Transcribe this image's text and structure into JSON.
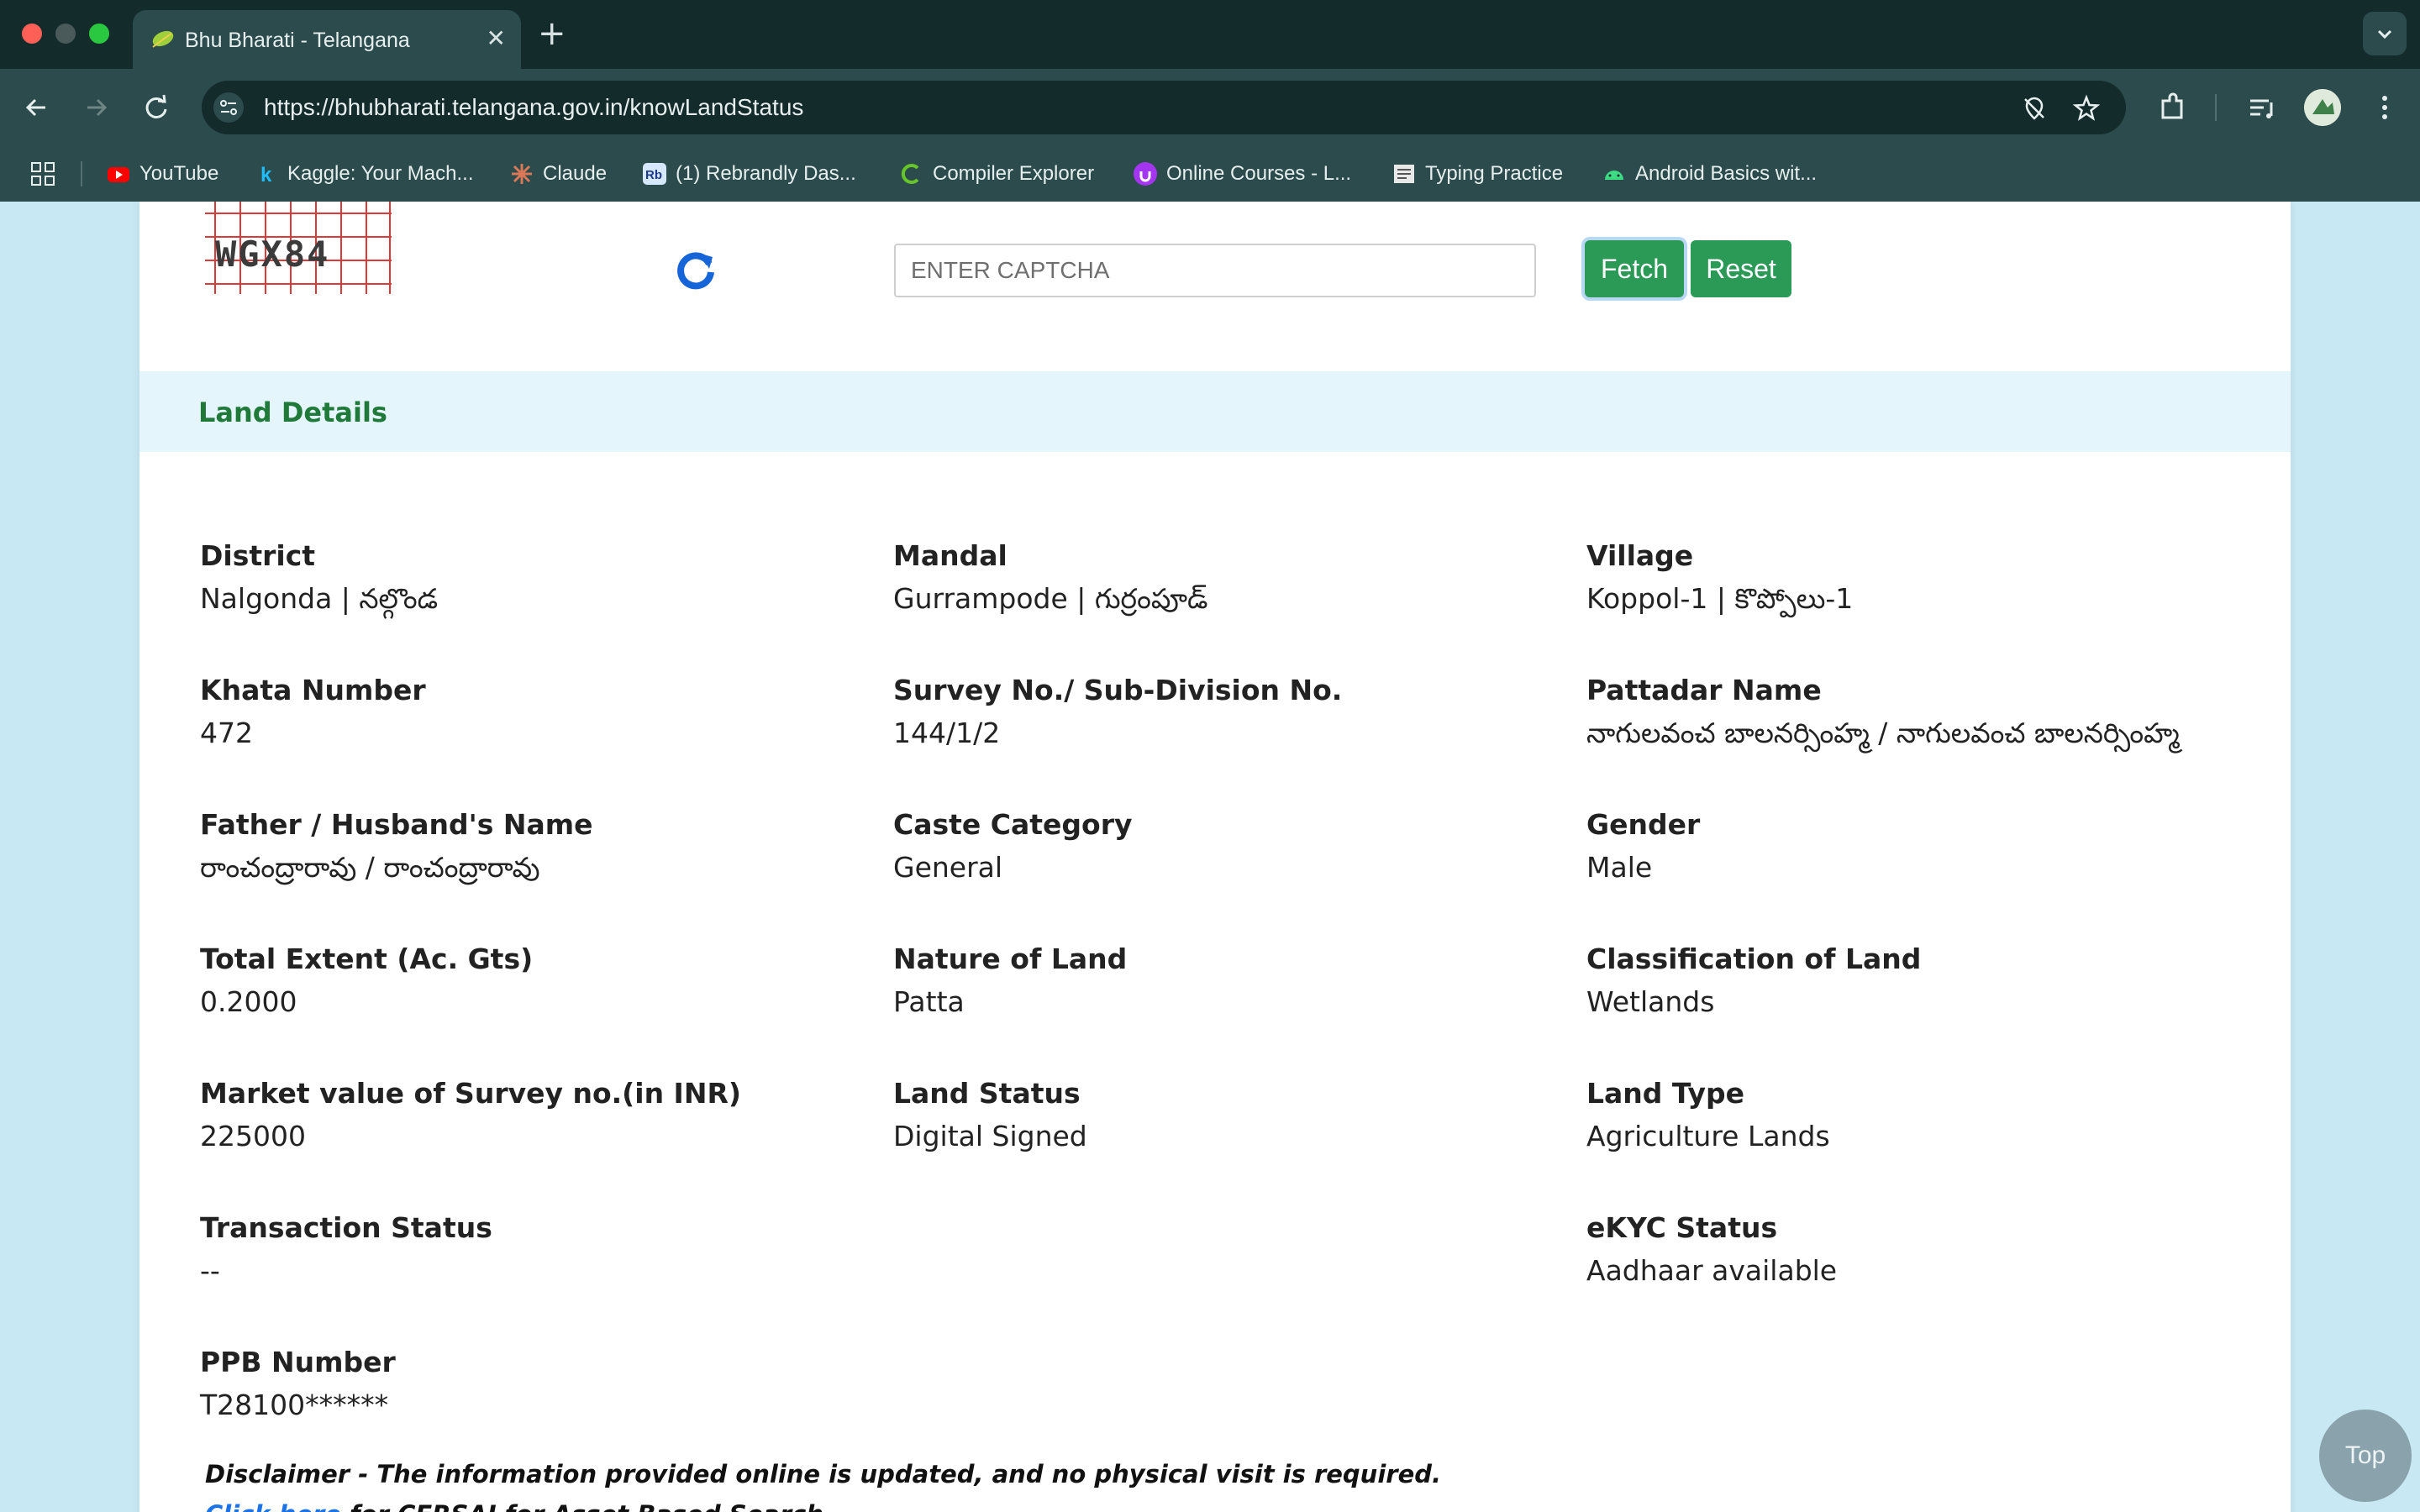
{
  "browser": {
    "tab_title": "Bhu Bharati - Telangana",
    "tab_close": "✕",
    "new_tab": "+",
    "url": "https://bhubharati.telangana.gov.in/knowLandStatus",
    "bookmarks": [
      {
        "label": "YouTube",
        "icon": "youtube-icon"
      },
      {
        "label": "Kaggle: Your Mach...",
        "icon": "kaggle-icon"
      },
      {
        "label": "Claude",
        "icon": "claude-icon"
      },
      {
        "label": "(1) Rebrandly Das...",
        "icon": "rebrandly-icon"
      },
      {
        "label": "Compiler Explorer",
        "icon": "compiler-explorer-icon"
      },
      {
        "label": "Online Courses - L...",
        "icon": "udemy-icon"
      },
      {
        "label": "Typing Practice",
        "icon": "typing-icon"
      },
      {
        "label": "Android Basics wit...",
        "icon": "android-icon"
      }
    ]
  },
  "captcha": {
    "code": "WGX84",
    "placeholder": "ENTER CAPTCHA",
    "fetch_label": "Fetch",
    "reset_label": "Reset"
  },
  "section": {
    "title": "Land Details"
  },
  "fields": {
    "district": {
      "label": "District",
      "value": "Nalgonda | నల్గొండ"
    },
    "mandal": {
      "label": "Mandal",
      "value": "Gurrampode | గుర్రంపూడ్"
    },
    "village": {
      "label": "Village",
      "value": "Koppol-1 | కొప్పోలు-1"
    },
    "khata": {
      "label": "Khata Number",
      "value": "472"
    },
    "survey": {
      "label": "Survey No./ Sub-Division No.",
      "value": "144/1/2"
    },
    "pattadar": {
      "label": "Pattadar Name",
      "value": "నాగులవంచ బాలనర్సింహ్మ / నాగులవంచ బాలనర్సింహ్మ"
    },
    "father": {
      "label": "Father / Husband's Name",
      "value": "రాంచంద్రారావు / రాంచంద్రారావు"
    },
    "caste": {
      "label": "Caste Category",
      "value": "General"
    },
    "gender": {
      "label": "Gender",
      "value": "Male"
    },
    "extent": {
      "label": "Total Extent (Ac. Gts)",
      "value": "0.2000"
    },
    "nature": {
      "label": "Nature of Land",
      "value": "Patta"
    },
    "classification": {
      "label": "Classification of Land",
      "value": "Wetlands"
    },
    "market": {
      "label": "Market value of Survey no.(in INR)",
      "value": "225000"
    },
    "land_status": {
      "label": "Land Status",
      "value": "Digital Signed"
    },
    "land_type": {
      "label": "Land Type",
      "value": "Agriculture Lands"
    },
    "transaction": {
      "label": "Transaction Status",
      "value": "--"
    },
    "ekyc": {
      "label": "eKYC Status",
      "value": "Aadhaar available"
    },
    "ppb": {
      "label": "PPB Number",
      "value": "T28100******"
    }
  },
  "disclaimer": {
    "text": "Disclaimer - The information provided online is updated, and no physical visit is required.",
    "link_label": "Click here",
    "link_suffix": " for CERSAI for Asset Based Search"
  },
  "top_button": "Top",
  "colors": {
    "accent_green": "#2b9a57",
    "section_title": "#1f7a3a",
    "section_bg": "#e4f5fb",
    "page_bg": "#c8e8f4",
    "chrome_dark": "#142b2c",
    "chrome_mid": "#2b4b4c"
  }
}
